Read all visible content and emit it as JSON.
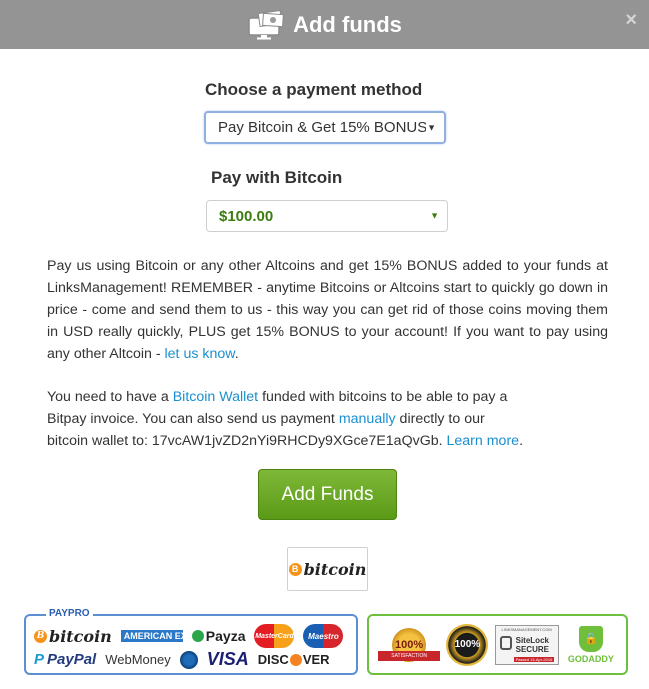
{
  "header": {
    "title": "Add funds",
    "icon": "money-monitor-icon",
    "close_label": "×"
  },
  "payment_method": {
    "label": "Choose a payment method",
    "selected": "Pay Bitcoin & Get 15% BONUS"
  },
  "bitcoin": {
    "label": "Pay with Bitcoin",
    "amount_selected": "$100.00",
    "amount_color": "#3a7d0e"
  },
  "paragraph1": {
    "text": "Pay us using Bitcoin or any other Altcoins and get 15% BONUS added to your funds at LinksManagement! REMEMBER - anytime Bitcoins or Altcoins start to quickly go down in price - come and send them to us - this way you can get rid of those coins moving them in USD really quickly, PLUS get 15% BONUS to your account! If you want to pay using any other Altcoin - ",
    "link": "let us know",
    "end": "."
  },
  "paragraph2": {
    "part1": "You need to have a ",
    "link_wallet": "Bitcoin Wallet",
    "part2": " funded with bitcoins to be able to pay a",
    "part3": "Bitpay invoice. You can also send us payment ",
    "link_manually": "manually",
    "part4": " directly to our",
    "part5": "bitcoin wallet to: 17vcAW1jvZD2nYi9RHCDy9XGce7E1aQvGb. ",
    "link_learn": "Learn more",
    "end": "."
  },
  "add_funds_button": "Add Funds",
  "bitcoin_badge": {
    "coin": "B",
    "word": "bitcoin"
  },
  "payment_logos": {
    "brand": "PAYPRO",
    "bitcoin": "bitcoin",
    "amex": "AMERICAN EXPRESS",
    "payza": "Payza",
    "mastercard": "MasterCard",
    "maestro": "Maestro",
    "paypal_p": "P",
    "paypal": "PayPal",
    "webmoney": "WebMoney",
    "visa": "VISA",
    "discover_pre": "DISC",
    "discover_post": "VER"
  },
  "trust_seals": {
    "satisfaction_value": "100%",
    "satisfaction_text": "SATISFACTION GUARANTEE",
    "guarantee_value": "100%",
    "sitelock_top": "LINKSMANAGEMENT.COM",
    "sitelock_name_1": "SiteLock",
    "sitelock_name_2": "SECURE",
    "sitelock_date": "Passed 13-Apr-2016",
    "godaddy": "GODADDY"
  },
  "colors": {
    "header_bg": "#949494",
    "button_green": "#6aa827",
    "link_blue": "#1a8fd0",
    "payment_border": "#5b8fd2",
    "trust_border": "#6cbf3f"
  }
}
